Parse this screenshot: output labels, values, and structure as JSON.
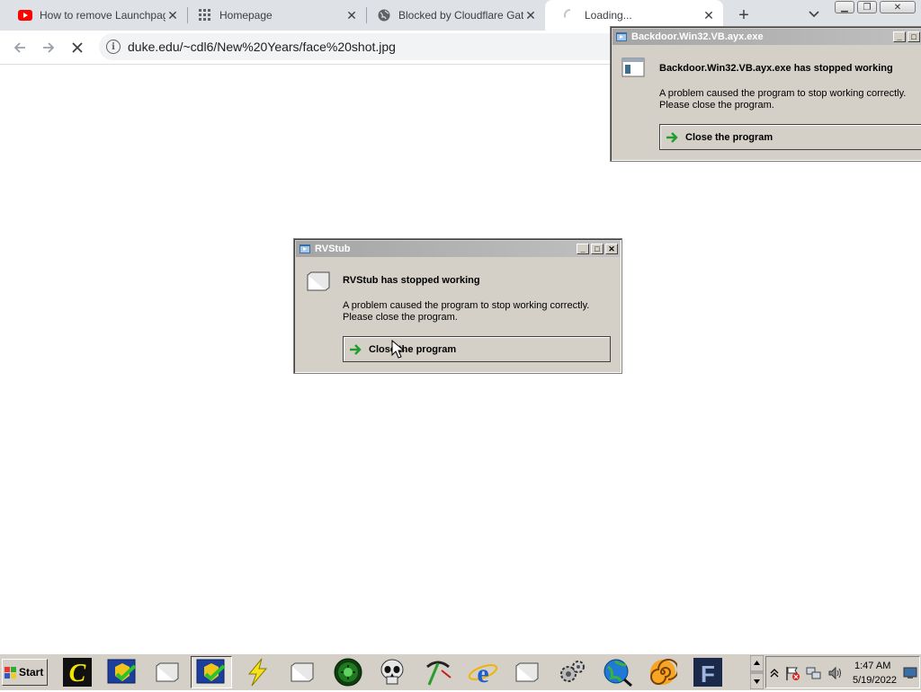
{
  "browser": {
    "tabs": [
      {
        "title": "How to remove Launchpage",
        "favicon": "youtube-icon"
      },
      {
        "title": "Homepage",
        "favicon": "apps-grid-icon"
      },
      {
        "title": "Blocked by Cloudflare Gatew",
        "favicon": "globe-icon"
      },
      {
        "title": "Loading...",
        "favicon": "loading-spinner-icon",
        "active": true
      }
    ],
    "url": "duke.edu/~cdl6/New%20Years/face%20shot.jpg"
  },
  "dialogs": {
    "backdoor": {
      "title": "Backdoor.Win32.VB.ayx.exe",
      "heading": "Backdoor.Win32.VB.ayx.exe has stopped working",
      "message_line1": "A problem caused the program to stop working correctly.",
      "message_line2": "Please close the program.",
      "button": "Close the program"
    },
    "rvstub": {
      "title": "RVStub",
      "heading": "RVStub has stopped working",
      "message_line1": "A problem caused the program to stop working correctly.",
      "message_line2": "Please close the program.",
      "button": "Close the program"
    }
  },
  "taskbar": {
    "start_label": "Start",
    "icons": [
      "c-app-icon",
      "security-shield-icon",
      "folder-icon",
      "security-shield-icon",
      "lightning-icon",
      "folder-icon",
      "green-orb-icon",
      "skull-icon",
      "pickaxe-icon",
      "internet-explorer-icon",
      "folder-icon",
      "gears-icon",
      "globe-search-icon",
      "spiral-icon",
      "f-app-icon"
    ],
    "clock_time": "1:47 AM",
    "clock_date": "5/19/2022"
  },
  "colors": {
    "tabstrip": "#dee1e6",
    "dialog_face": "#d4d0c8",
    "dialog_titlebar_inactive": "#a5a5a5",
    "ie_blue": "#1b5fd1"
  }
}
